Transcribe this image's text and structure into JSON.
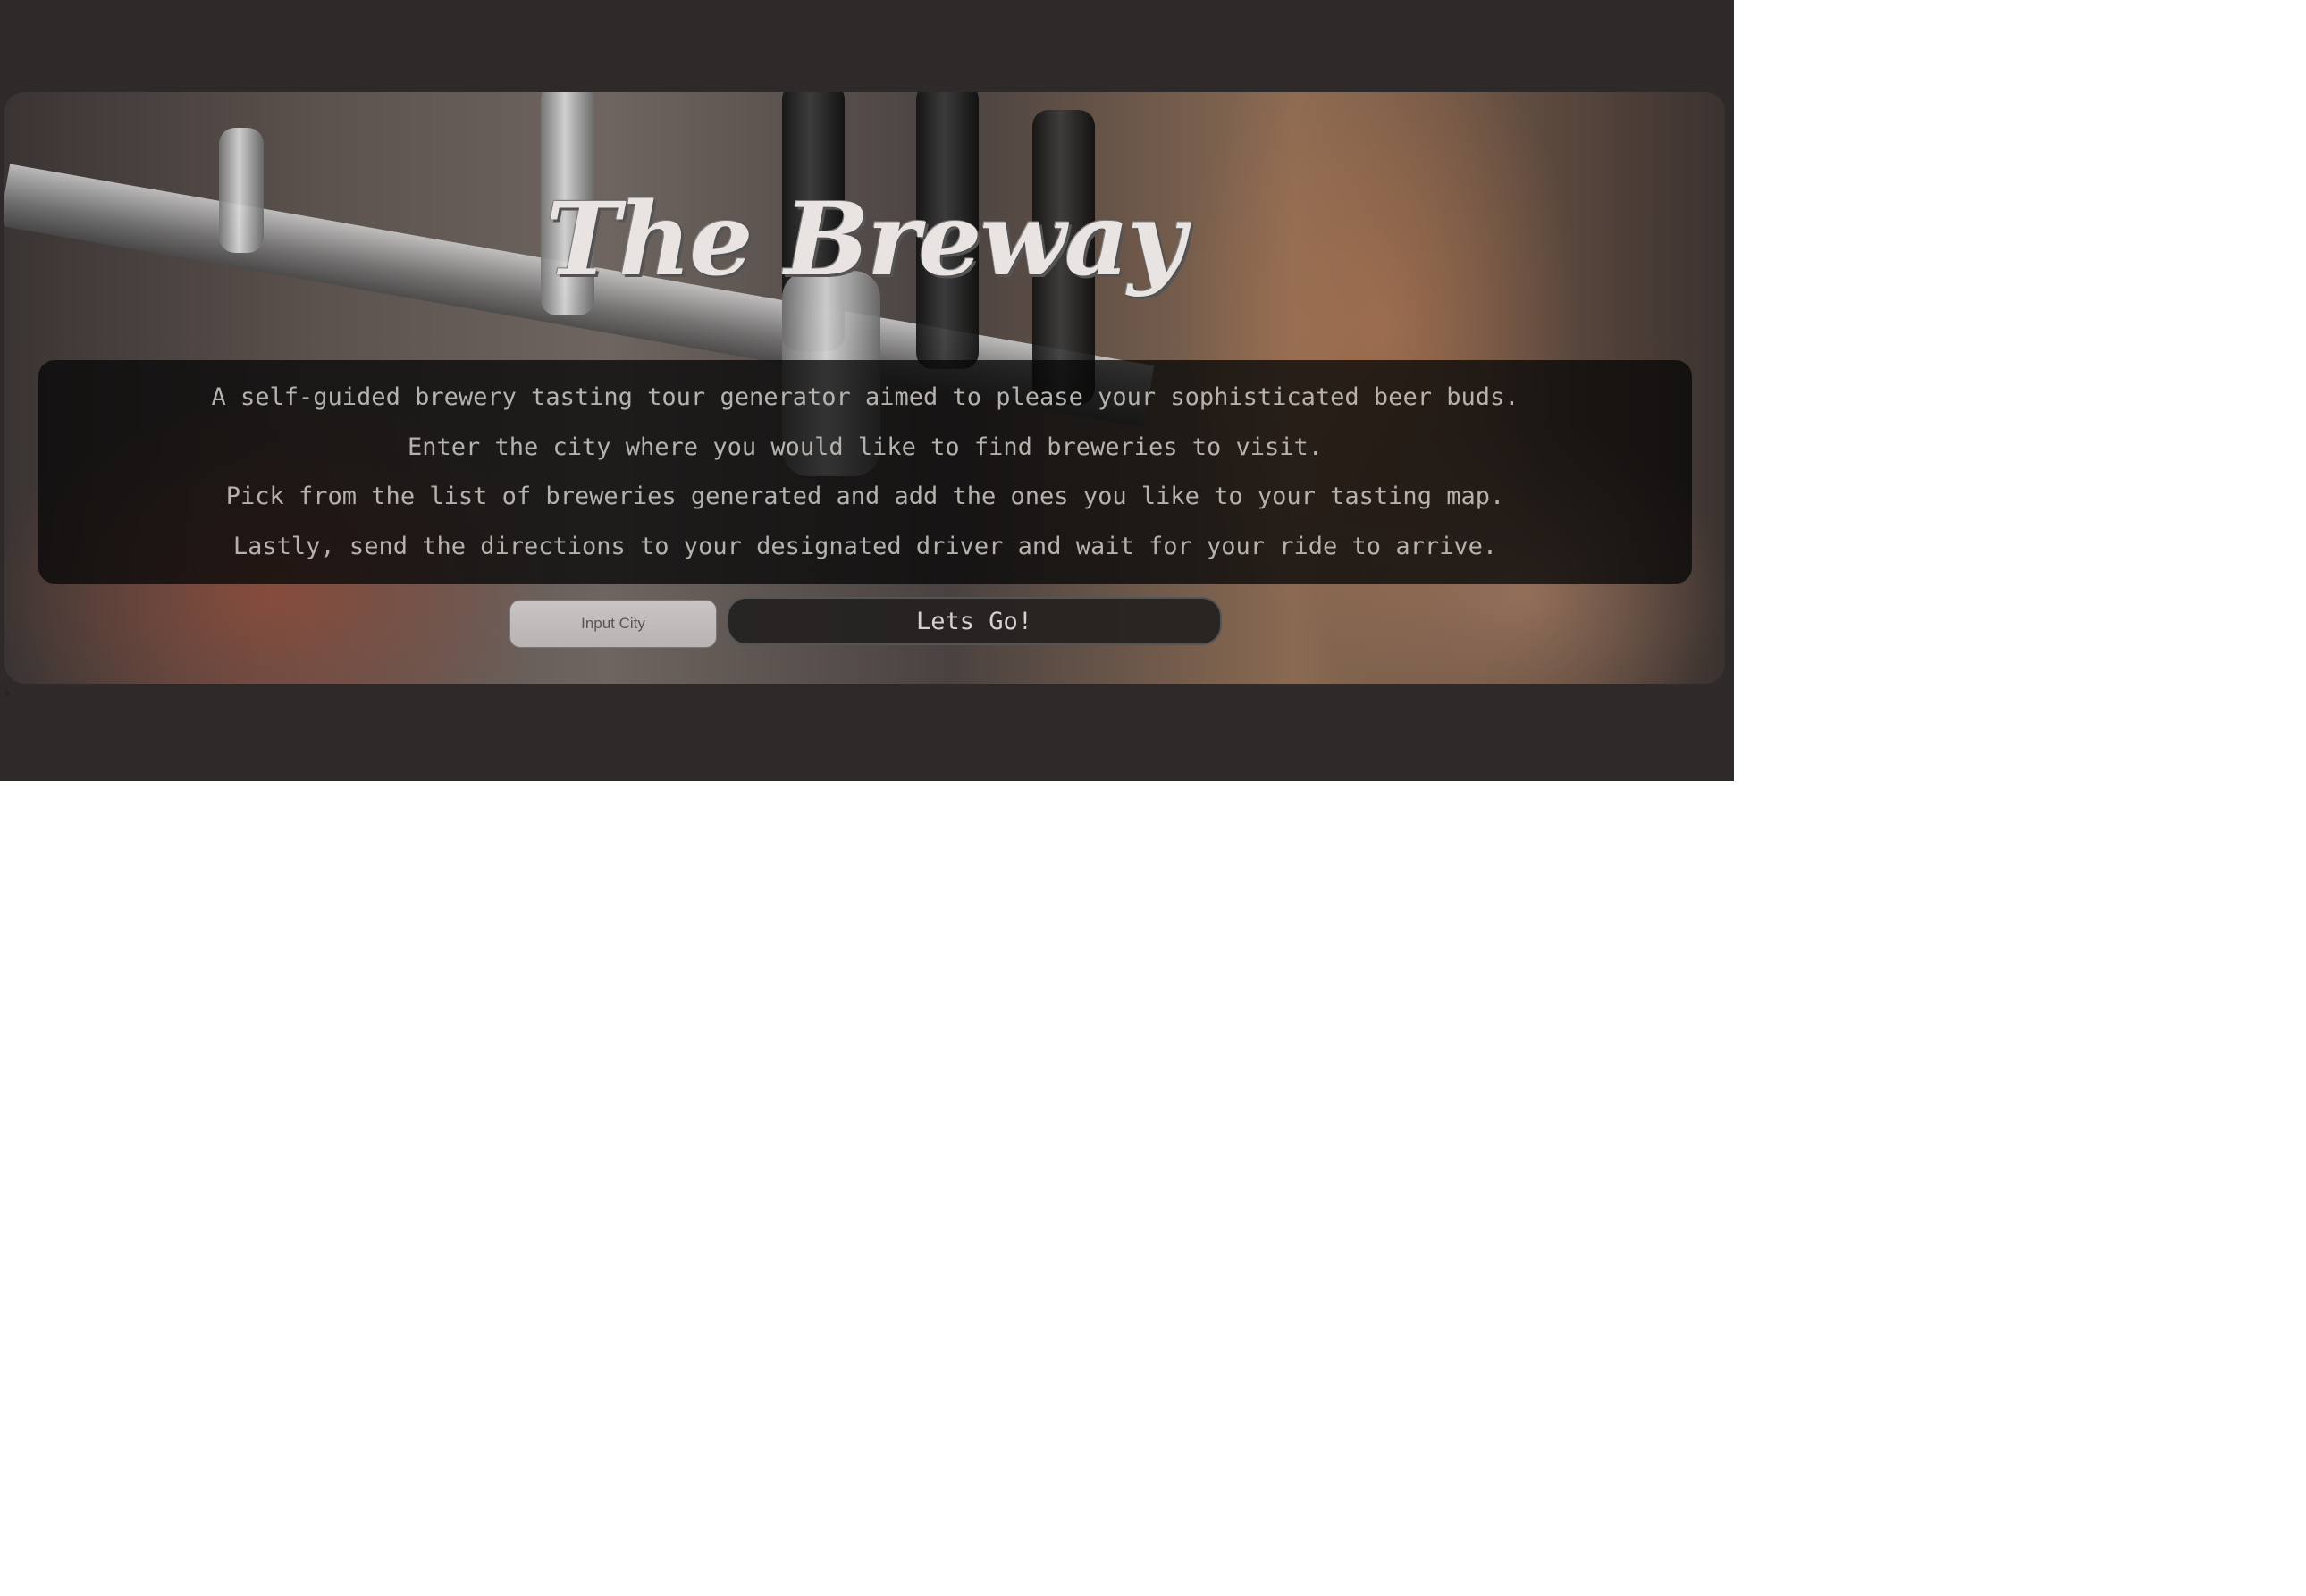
{
  "hero": {
    "title": "The Breway",
    "description_lines": [
      "A self-guided brewery tasting tour generator aimed to please your sophisticated beer buds.",
      "Enter the city where you would like to find breweries to visit.",
      "Pick from the list of breweries generated and add the ones you like to your tasting map.",
      "Lastly, send the directions to your designated driver and wait for your ride to arrive."
    ]
  },
  "search": {
    "placeholder": "Input City",
    "value": "",
    "submit_label": "Lets Go!"
  },
  "stray_mark": "›",
  "colors": {
    "page_background": "#2e2a29",
    "panel_background": "#080808",
    "text": "#b6b1ad",
    "title": "#e9e4e2"
  }
}
